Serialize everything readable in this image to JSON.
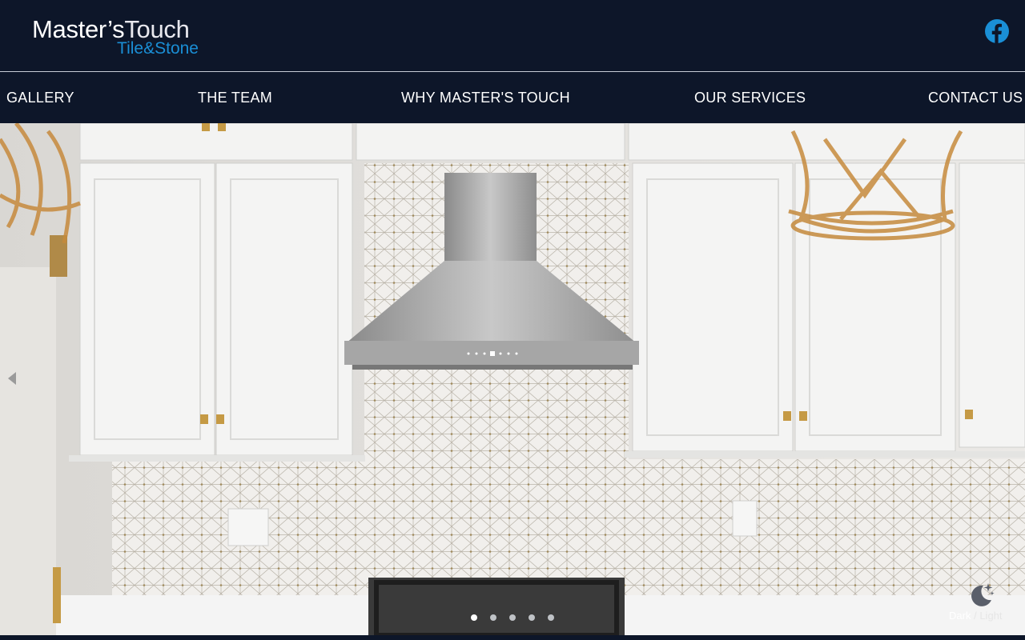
{
  "brand": {
    "name_bold": "Master’s",
    "name_light": "Touch",
    "tagline": "Tile&Stone",
    "colors": {
      "navy": "#0d1629",
      "blue": "#1a8fd6",
      "white": "#ffffff"
    }
  },
  "social": {
    "facebook_icon": "facebook-icon"
  },
  "nav": {
    "items": [
      {
        "label": "GALLERY"
      },
      {
        "label": "THE TEAM"
      },
      {
        "label": "WHY MASTER'S TOUCH"
      },
      {
        "label": "OUR SERVICES"
      },
      {
        "label": "CONTACT US"
      }
    ]
  },
  "hero": {
    "slides_count": 5,
    "active_slide": 1,
    "prev_icon": "chevron-left-icon"
  },
  "theme_toggle": {
    "dark_label": "Dark",
    "separator": "/",
    "light_label": "Light",
    "icon": "moon-stars-icon"
  }
}
